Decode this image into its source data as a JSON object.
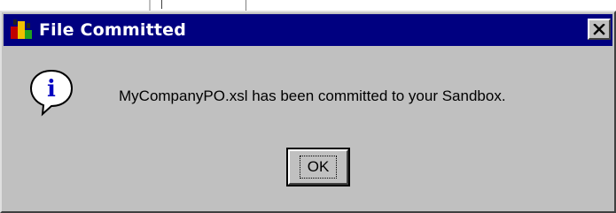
{
  "window": {
    "title": "File Committed",
    "title_icon": "application-icon",
    "close_icon": "close-icon",
    "close_glyph": "x"
  },
  "message": {
    "icon": "information-icon",
    "icon_glyph": "i",
    "text": "MyCompanyPO.xsl has been committed to your Sandbox."
  },
  "buttons": {
    "ok_label": "OK"
  },
  "colors": {
    "titlebar": "#000080",
    "dialog_face": "#c0c0c0",
    "info_icon": "#0000c0"
  }
}
